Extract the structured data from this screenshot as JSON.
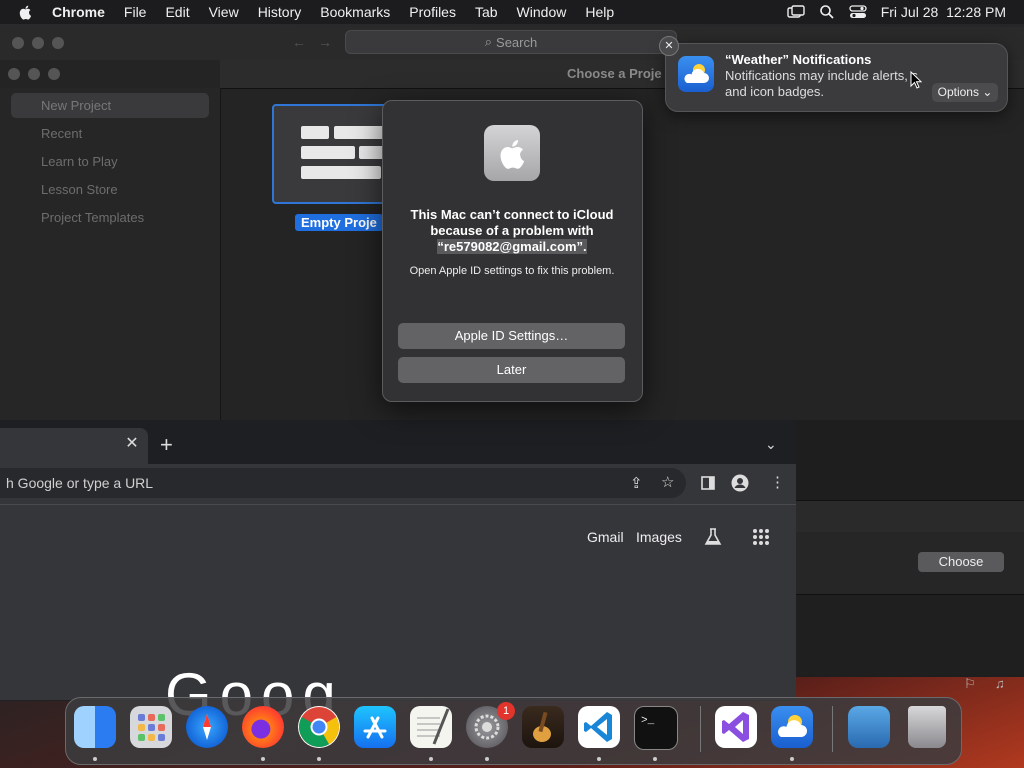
{
  "menubar": {
    "app": "Chrome",
    "items": [
      "File",
      "Edit",
      "View",
      "History",
      "Bookmarks",
      "Profiles",
      "Tab",
      "Window",
      "Help"
    ],
    "datetime": "Fri Jul 28  12:28 PM"
  },
  "bg_window": {
    "search_placeholder": "Search",
    "chooser_title": "Choose a Proje",
    "sidebar_items": [
      "New Project",
      "Recent",
      "Learn to Play",
      "Lesson Store",
      "Project Templates"
    ],
    "template_label": "Empty Proje",
    "choose_button": "Choose"
  },
  "dialog": {
    "title_line1": "This Mac can’t connect to iCloud",
    "title_line2": "because of a problem with",
    "title_email": "“re579082@gmail.com”.",
    "message": "Open Apple ID settings to fix this problem.",
    "primary_button": "Apple ID Settings…",
    "secondary_button": "Later"
  },
  "notification": {
    "title": "“Weather” Notifications",
    "body": "Notifications may include alerts, s and icon badges.",
    "options_label": "Options"
  },
  "chrome": {
    "omnibox_placeholder": "h Google or type a URL",
    "gmail": "Gmail",
    "images": "Images",
    "logo_partial": "Goog"
  },
  "dock": {
    "settings_badge": "1",
    "apps": [
      "finder-icon",
      "launchpad-icon",
      "safari-icon",
      "firefox-icon",
      "chrome-icon",
      "app-store-icon",
      "textedit-icon",
      "system-settings-icon",
      "garageband-icon",
      "vscode-icon",
      "terminal-icon",
      "visual-studio-icon",
      "weather-icon",
      "downloads-stack-icon",
      "trash-icon"
    ]
  }
}
